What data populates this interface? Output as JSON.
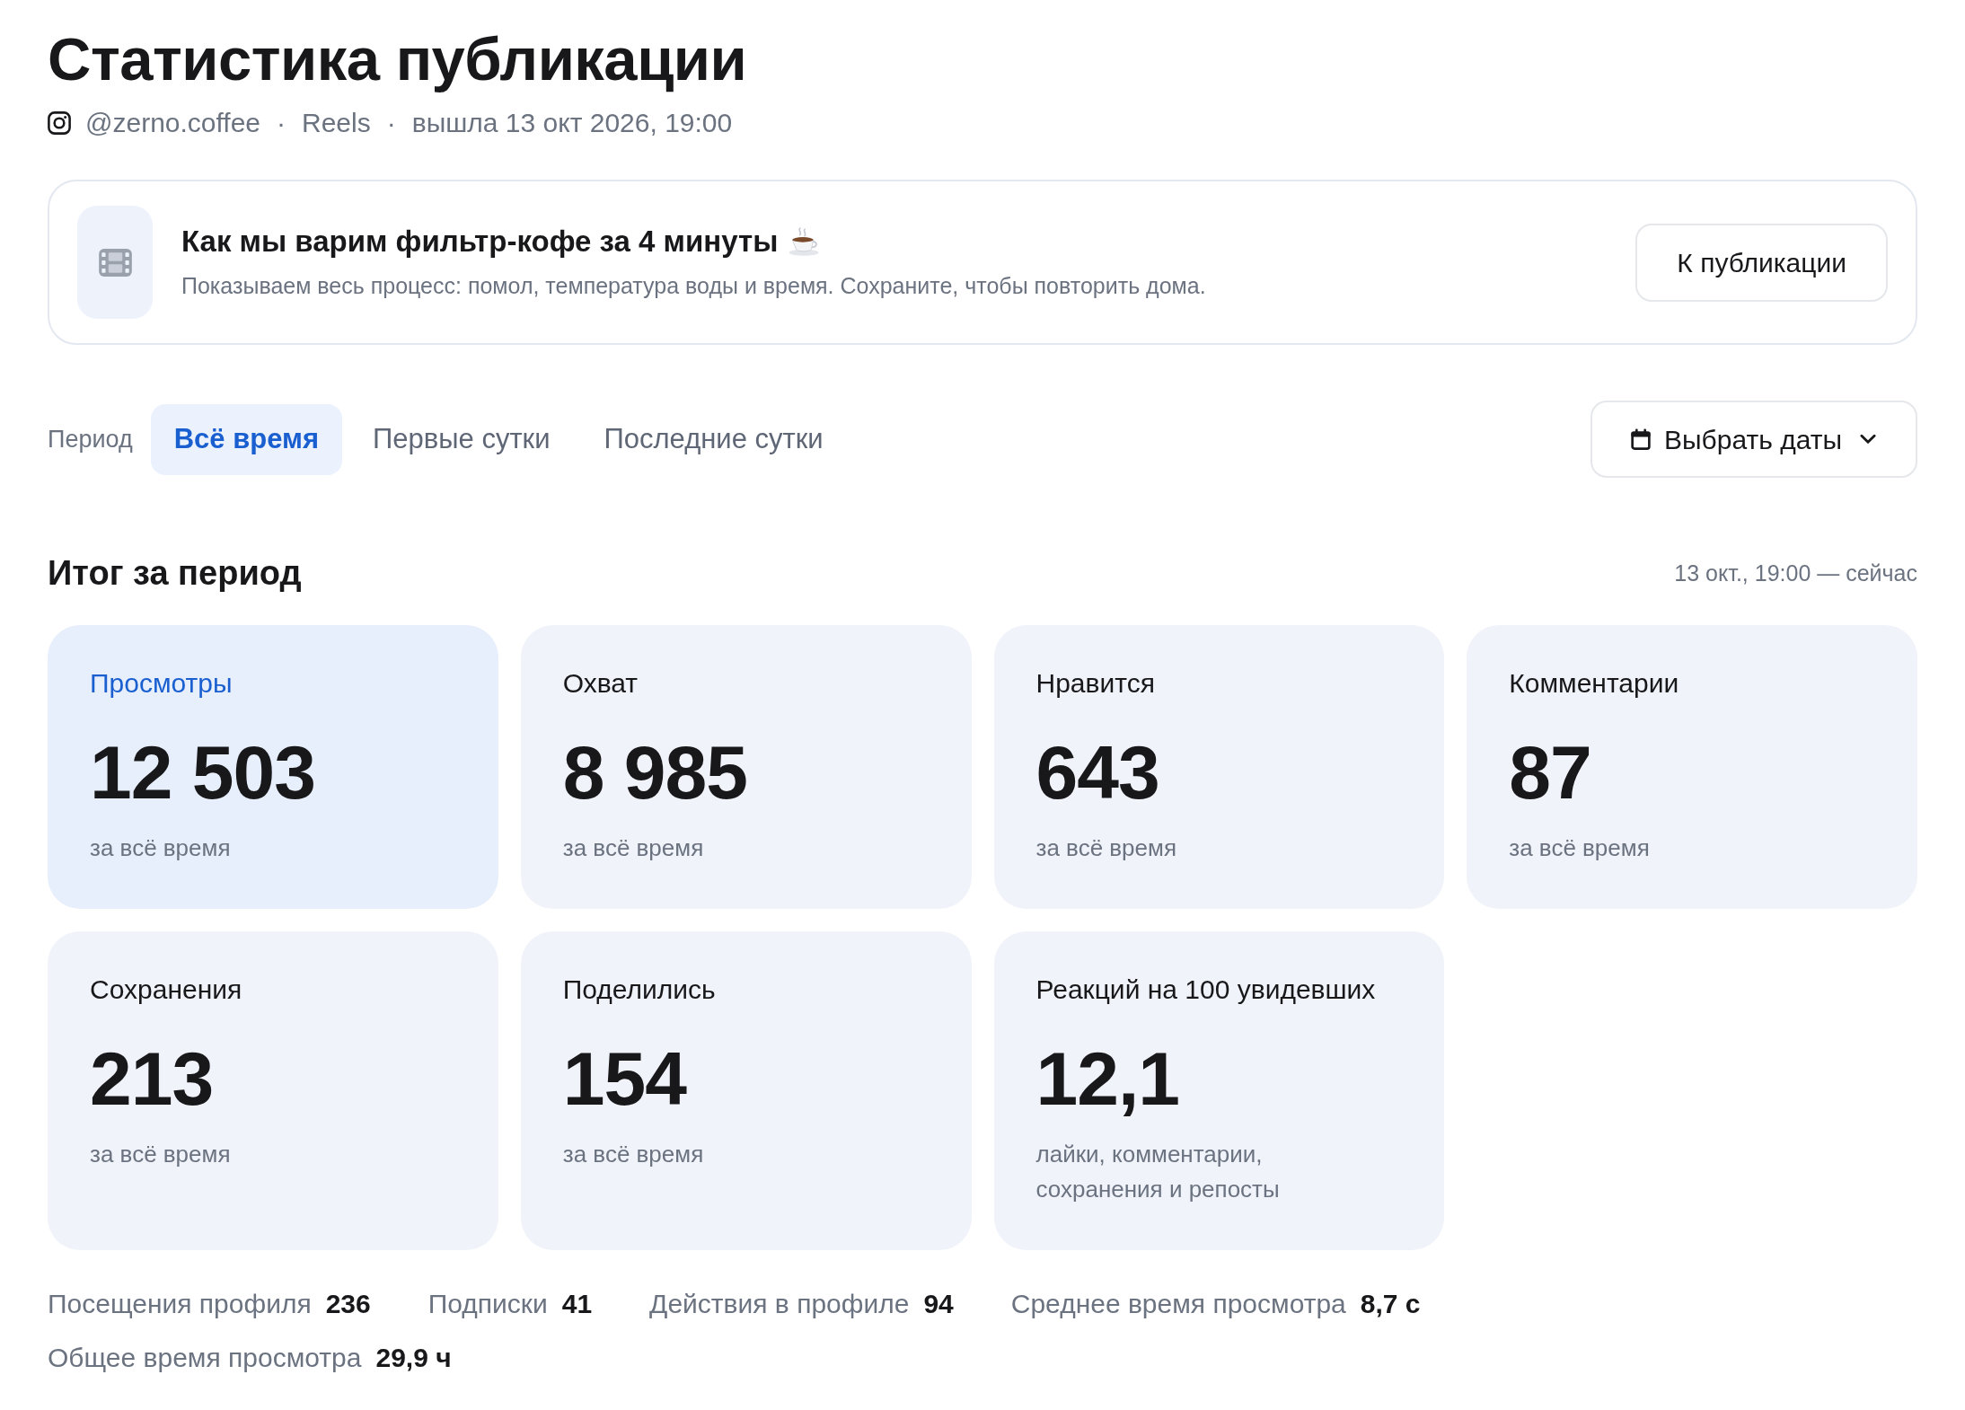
{
  "page": {
    "title": "Статистика публикации"
  },
  "meta": {
    "items": [
      "@zerno.coffee",
      "Reels",
      "вышла 13 окт 2026, 19:00"
    ],
    "separators": [
      "·",
      "·"
    ]
  },
  "post": {
    "title": "Как мы варим фильтр-кофе за 4 минуты",
    "description": "Показываем весь процесс: помол, температура воды и время. Сохраните, чтобы повторить дома.",
    "button": "К публикации"
  },
  "period": {
    "label": "Период",
    "tabs": [
      {
        "label": "Всё время",
        "selected": true
      },
      {
        "label": "Первые сутки",
        "selected": false
      },
      {
        "label": "Последние сутки",
        "selected": false
      }
    ],
    "date_button": "Выбрать даты"
  },
  "summary": {
    "title": "Итог за период",
    "range": "13 окт., 19:00 — сейчас",
    "metrics": [
      {
        "label": "Просмотры",
        "value": "12 503",
        "note": "за всё время",
        "selected": true
      },
      {
        "label": "Охват",
        "value": "8 985",
        "note": "за всё время",
        "selected": false
      },
      {
        "label": "Нравится",
        "value": "643",
        "note": "за всё время",
        "selected": false
      },
      {
        "label": "Комментарии",
        "value": "87",
        "note": "за всё время",
        "selected": false
      },
      {
        "label": "Сохранения",
        "value": "213",
        "note": "за всё время",
        "selected": false
      },
      {
        "label": "Поделились",
        "value": "154",
        "note": "за всё время",
        "selected": false
      },
      {
        "label": "Реакций на 100 увидевших",
        "value": "12,1",
        "note": "лайки, комментарии, сохранения и репосты",
        "selected": false
      }
    ]
  },
  "profile_stats": [
    {
      "label": "Посещения профиля",
      "value": "236"
    },
    {
      "label": "Подписки",
      "value": "41"
    },
    {
      "label": "Действия в профиле",
      "value": "94"
    },
    {
      "label": "Среднее время просмотра",
      "value": "8,7 с"
    },
    {
      "label": "Общее время просмотра",
      "value": "29,9 ч"
    }
  ]
}
